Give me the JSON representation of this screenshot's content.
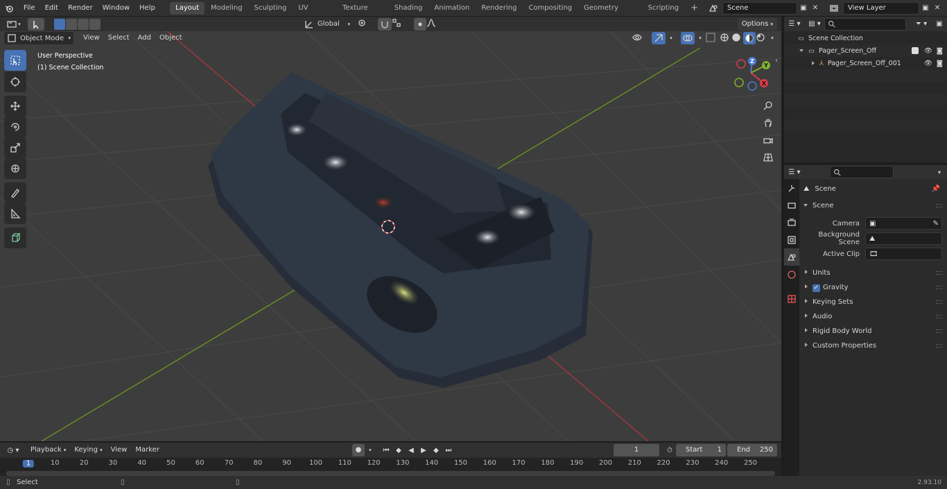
{
  "app": {
    "version": "2.93.10"
  },
  "menu": {
    "items": [
      "File",
      "Edit",
      "Render",
      "Window",
      "Help"
    ]
  },
  "workspaces": {
    "tabs": [
      "Layout",
      "Modeling",
      "Sculpting",
      "UV Editing",
      "Texture Paint",
      "Shading",
      "Animation",
      "Rendering",
      "Compositing",
      "Geometry Nodes",
      "Scripting"
    ],
    "active": "Layout"
  },
  "scene": {
    "name": "Scene",
    "view_layer": "View Layer"
  },
  "viewport": {
    "mode": "Object Mode",
    "menus": [
      "View",
      "Select",
      "Add",
      "Object"
    ],
    "transform_orientation": "Global",
    "options_label": "Options",
    "overlay_line1": "User Perspective",
    "overlay_line2": "(1) Scene Collection",
    "gizmo_axes": {
      "z": "Z",
      "y": "Y",
      "x": "X"
    },
    "colors": {
      "bg": "#3d3d3d",
      "grid": "#4a4a4a",
      "x_axis": "#b3343f",
      "y_axis": "#6c9a1e",
      "model": "#2f3845"
    }
  },
  "outliner": {
    "root": "Scene Collection",
    "items": [
      {
        "name": "Pager_Screen_Off"
      },
      {
        "name": "Pager_Screen_Off_001"
      }
    ]
  },
  "properties": {
    "context": "Scene",
    "panel_title": "Scene",
    "fields": [
      {
        "label": "Camera"
      },
      {
        "label": "Background Scene"
      },
      {
        "label": "Active Clip"
      }
    ],
    "subpanels": [
      "Units",
      "Gravity",
      "Keying Sets",
      "Audio",
      "Rigid Body World",
      "Custom Properties"
    ]
  },
  "timeline": {
    "menus": [
      "Playback",
      "Keying",
      "View",
      "Marker"
    ],
    "current_frame": "1",
    "start_label": "Start",
    "start": "1",
    "end_label": "End",
    "end": "250",
    "ticks": [
      "1",
      "10",
      "20",
      "30",
      "40",
      "50",
      "60",
      "70",
      "80",
      "90",
      "100",
      "110",
      "120",
      "130",
      "140",
      "150",
      "160",
      "170",
      "180",
      "190",
      "200",
      "210",
      "220",
      "230",
      "240",
      "250"
    ]
  },
  "status": {
    "left": "Select",
    "version": "2.93.10"
  }
}
